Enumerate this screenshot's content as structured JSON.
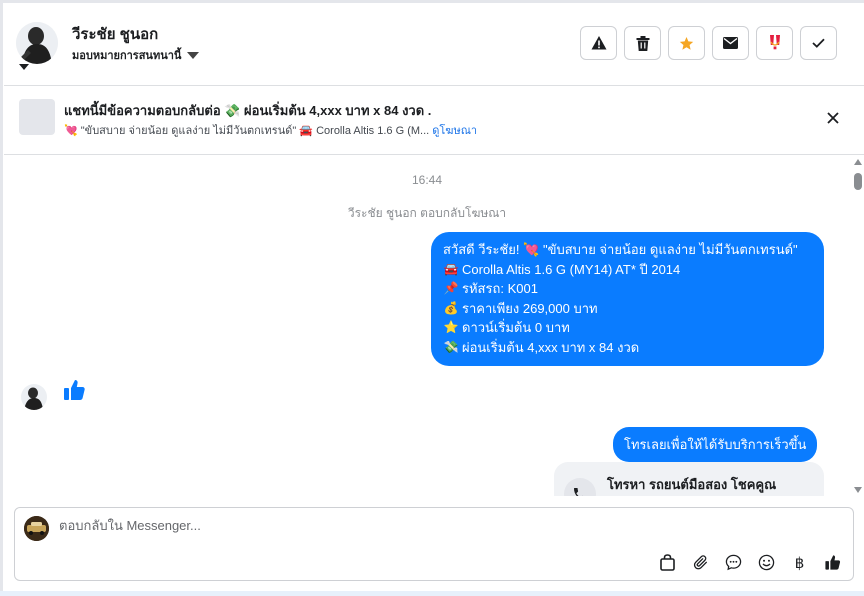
{
  "header": {
    "contact_name": "วีระชัย ชูนอก",
    "assign_label": "มอบหมายการสนทนานี้",
    "actions": [
      {
        "name": "spam-button",
        "icon": "warning-icon"
      },
      {
        "name": "delete-button",
        "icon": "trash-icon"
      },
      {
        "name": "star-button",
        "icon": "star-icon"
      },
      {
        "name": "mark-unread-button",
        "icon": "envelope-icon"
      },
      {
        "name": "follow-up-button",
        "icon": "exclamation-icon"
      },
      {
        "name": "done-button",
        "icon": "check-icon"
      }
    ]
  },
  "banner": {
    "title": "แชทนี้มีข้อความตอบกลับต่อ 💸 ผ่อนเริ่มต้น 4,xxx บาท x 84 งวด .",
    "subtitle": "\"ขับสบาย จ่ายน้อย ดูแลง่าย ไม่มีวันตกเทรนด์\" 🚘 Corolla Altis 1.6 G (M...",
    "subtitle_heart": "💘",
    "link_label": "ดูโฆษณา"
  },
  "thread": {
    "timestamp": "16:44",
    "system_note": "วีระชัย ชูนอก ตอบกลับโฆษณา",
    "ad_message": {
      "lines": [
        {
          "emoji": "",
          "text": "สวัสดี วีระชัย! 💘 \"ขับสบาย จ่ายน้อย ดูแลง่าย ไม่มีวันตกเทรนด์\""
        },
        {
          "emoji": "🚘",
          "text": "Corolla Altis 1.6 G (MY14) AT* ปี 2014"
        },
        {
          "emoji": "📌",
          "text": "รหัสรถ: K001"
        },
        {
          "emoji": "💰",
          "text": "ราคาเพียง 269,000 บาท"
        },
        {
          "emoji": "⭐",
          "text": "ดาวน์เริ่มต้น 0 บาท"
        },
        {
          "emoji": "💸",
          "text": "ผ่อนเริ่มต้น 4,xxx บาท x 84 งวด"
        }
      ]
    },
    "call_bubble": "โทรเลยเพื่อให้ได้รับบริการเร็วขึ้น",
    "call_card_title": "โทรหา รถยนต์มือสอง โชคคูณ"
  },
  "composer": {
    "placeholder": "ตอบกลับใน Messenger...",
    "currency_symbol": "฿"
  },
  "colors": {
    "accent": "#0a7cff",
    "star": "#f5a623",
    "exclaim": "#e41e3f"
  }
}
